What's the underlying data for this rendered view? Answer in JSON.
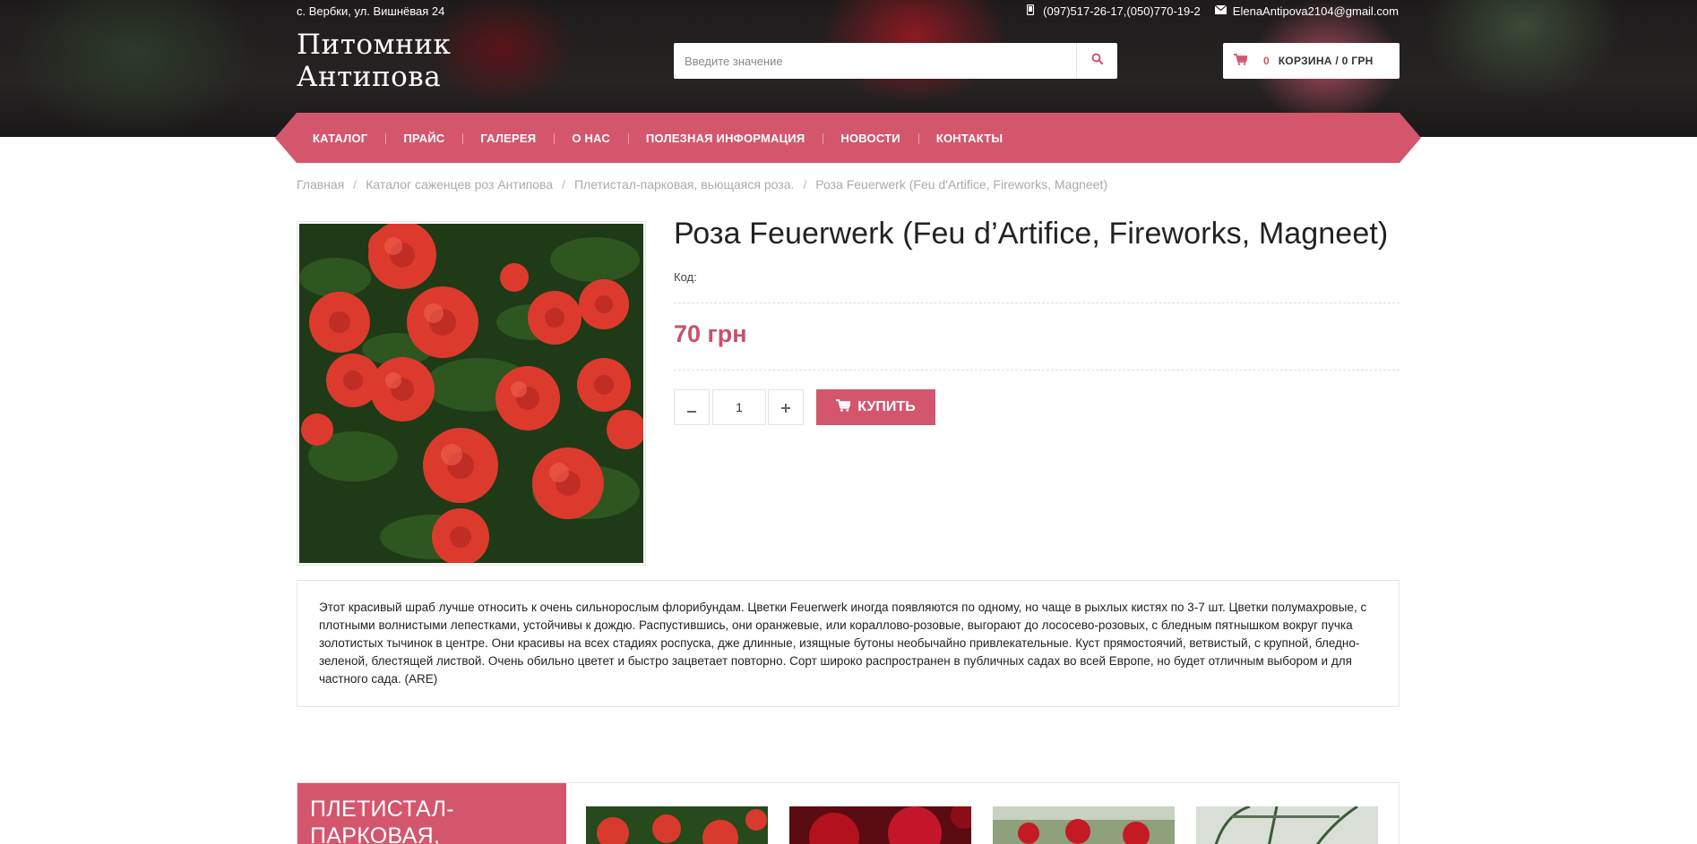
{
  "header": {
    "address": "с. Вербки, ул. Вишнёвая 24",
    "phones": "(097)517-26-17,(050)770-19-2",
    "email": "ElenaAntipova2104@gmail.com",
    "logo_line1": "Питомник",
    "logo_line2": "Антипова",
    "search_placeholder": "Введите значение",
    "cart_count": "0",
    "cart_label": "КОРЗИНА / 0 ГРН"
  },
  "nav": {
    "items": [
      "КАТАЛОГ",
      "ПРАЙС",
      "ГАЛЕРЕЯ",
      "О НАС",
      "ПОЛЕЗНАЯ ИНФОРМАЦИЯ",
      "НОВОСТИ",
      "КОНТАКТЫ"
    ]
  },
  "breadcrumb": [
    "Главная",
    "Каталог саженцев роз Антипова",
    "Плетистал-парковая, вьющаяся роза.",
    "Роза Feuerwerk (Feu d'Artifice, Fireworks, Magneet)"
  ],
  "product": {
    "title": "Роза Feuerwerk (Feu d’Artifice, Fireworks, Magneet)",
    "code_label": "Код:",
    "price": "70 грн",
    "qty": "1",
    "buy_label": "КУПИТЬ",
    "description": "Этот красивый шраб лучше относить к очень сильнорослым флорибундам. Цветки Feuerwerk иногда появляются по одному, но чаще в рыхлых кистях по 3-7 шт. Цветки полумахровые, с плотными волнистыми лепестками, устойчивы к дождю. Распустившись, они оранжевые, или кораллово-розовые, выгорают до лососево-розовых, с бледным пятнышком вокруг пучка золотистых тычинок в центре. Они красивы на всех стадиях роспуска, дже длинные, изящные бутоны необычайно привлекательные. Куст прямостоячий, ветвистый, с крупной, бледно-зеленой, блестящей листвой. Очень обильно цветет и быстро зацветает повторно. Сорт широко распространен в публичных садах во всей Европе, но будет отличным выбором и для частного сада. (ARE)"
  },
  "category": {
    "line1": "ПЛЕТИСТАЛ-",
    "line2": "ПАРКОВАЯ,"
  },
  "colors": {
    "accent": "#d4566d",
    "price": "#c9506a"
  },
  "icons": {
    "phone": "mobile-icon",
    "email": "envelope-icon",
    "search": "search-icon",
    "cart": "cart-icon"
  }
}
